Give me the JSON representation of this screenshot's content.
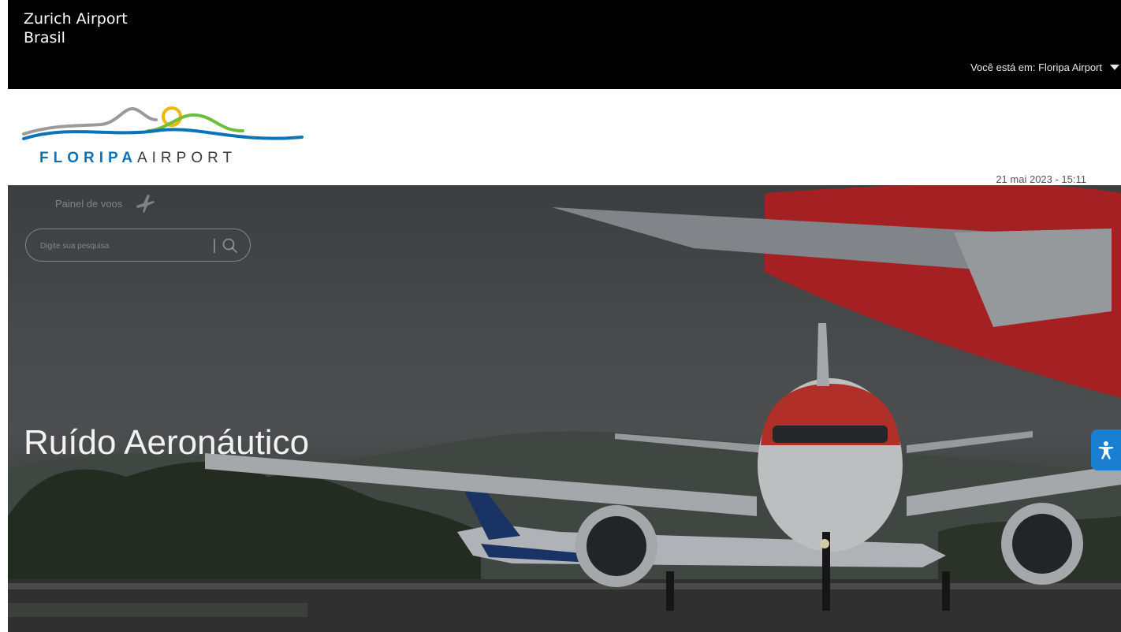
{
  "topbar": {
    "brand_line1": "Zurich Airport",
    "brand_line2": "Brasil",
    "location_label": "Você está em: Floripa Airport"
  },
  "logo": {
    "word_primary": "FLORIPA",
    "word_secondary": "AIRPORT",
    "colors": {
      "primary": "#0c73b8",
      "accent_yellow": "#f2b705",
      "accent_green": "#6cbf3b",
      "accent_gray": "#9a9a9a"
    }
  },
  "header": {
    "datetime": "21 mai 2023 - 15:11"
  },
  "hero": {
    "panel_link_label": "Painel de voos",
    "search_placeholder": "Digite sua pesquisa",
    "title": "Ruído Aeronáutico"
  },
  "icons": {
    "plane": "plane-icon",
    "search": "search-icon",
    "caret": "chevron-down-icon",
    "accessibility": "accessibility-icon"
  }
}
